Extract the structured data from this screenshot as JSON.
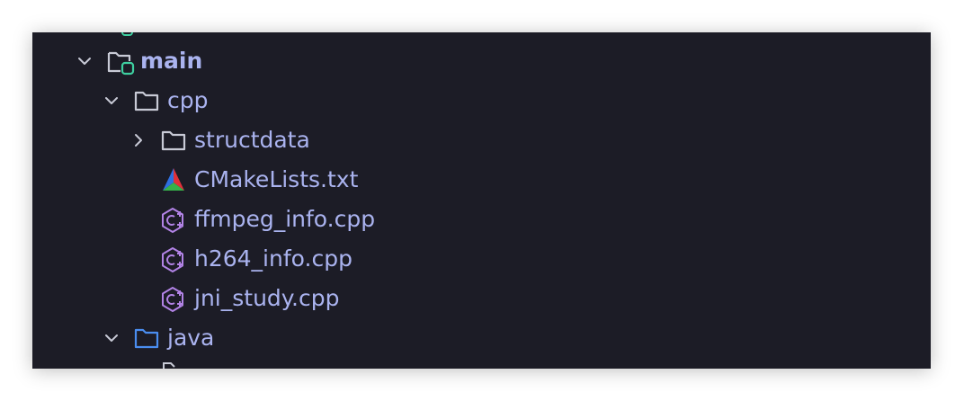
{
  "colors": {
    "panel_bg": "#1c1c26",
    "text": "#aab3ef",
    "chevron": "#c8cad6",
    "folder_outline": "#c8cad6",
    "source_folder_outline": "#4a8df0",
    "module_badge": "#3ecfa0",
    "cpp_icon": "#b283e6"
  },
  "tree": {
    "main": {
      "label": "main",
      "expanded": true,
      "icon": "module-folder-icon"
    },
    "cpp": {
      "label": "cpp",
      "expanded": true,
      "icon": "folder-icon"
    },
    "structdata": {
      "label": "structdata",
      "expanded": false,
      "icon": "folder-icon"
    },
    "files": [
      {
        "label": "CMakeLists.txt",
        "icon": "cmake-icon"
      },
      {
        "label": "ffmpeg_info.cpp",
        "icon": "cpp-file-icon"
      },
      {
        "label": "h264_info.cpp",
        "icon": "cpp-file-icon"
      },
      {
        "label": "jni_study.cpp",
        "icon": "cpp-file-icon"
      }
    ],
    "java": {
      "label": "java",
      "expanded": true,
      "icon": "source-folder-icon"
    }
  }
}
